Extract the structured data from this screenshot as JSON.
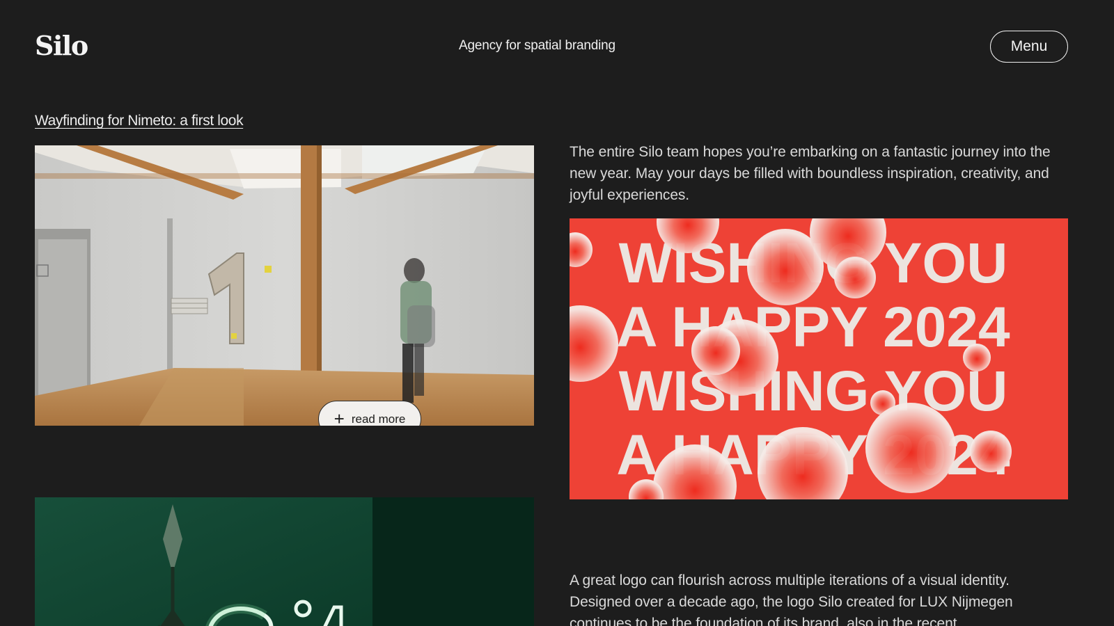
{
  "header": {
    "logo": "Silo",
    "tagline": "Agency for spatial branding",
    "menu_label": "Menu"
  },
  "feed": {
    "article1": {
      "title": "Wayfinding for Nimeto: a first look",
      "read_more_label": "read more",
      "image_icon": "wayfinding-photo"
    },
    "article2": {
      "text": "The entire Silo team hopes you’re embarking on a fantastic journey into the new year. May your days be filled with boundless inspiration, creativity, and joyful experiences.",
      "graphic_lines": [
        "WISHING YOU",
        "A HAPPY 2024",
        "WISHING YOU",
        "A HAPPY 2024"
      ],
      "accent_color": "#ee4236"
    },
    "article3": {
      "text": "A great logo can flourish across multiple iterations of a visual identity. Designed over a decade ago, the logo Silo created for LUX Nijmegen continues to be the foundation of its brand, also in the recent",
      "image_icon": "neon-sign-photo"
    }
  }
}
